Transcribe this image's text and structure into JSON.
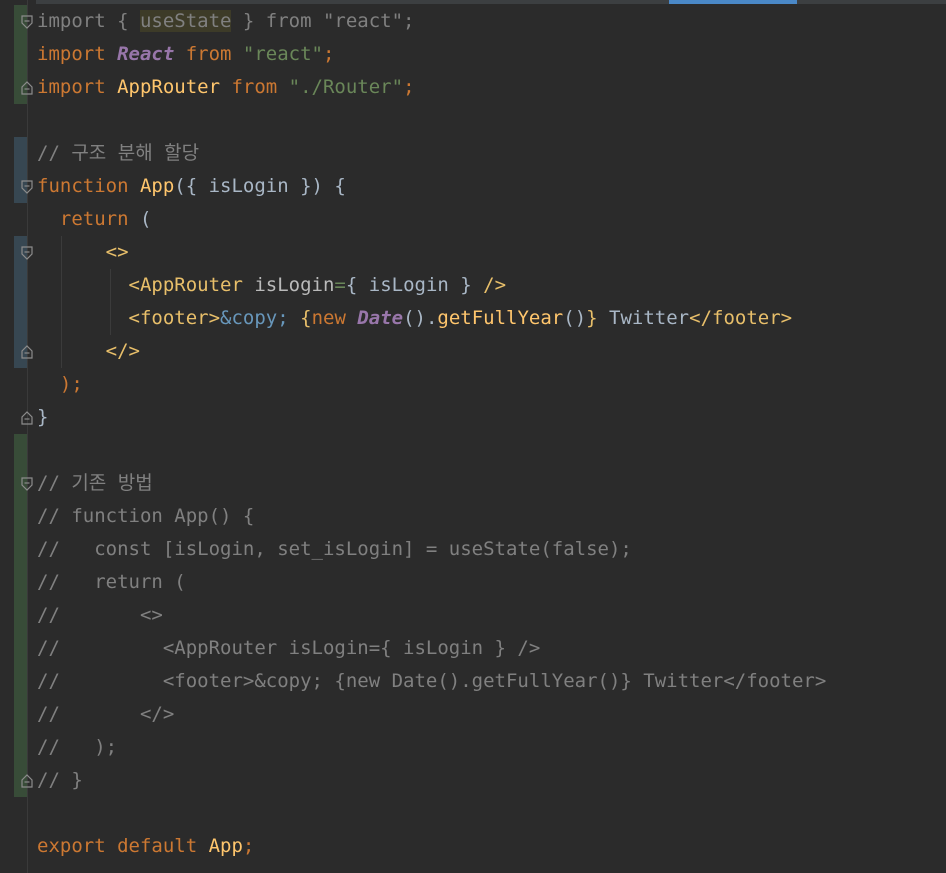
{
  "editor": {
    "lines": [
      {
        "tokens": [
          {
            "t": "import { ",
            "c": "dim"
          },
          {
            "t": "useState",
            "c": "unused hl"
          },
          {
            "t": " } from \"react\";",
            "c": "dim"
          }
        ]
      },
      {
        "tokens": [
          {
            "t": "import ",
            "c": "kw"
          },
          {
            "t": "React",
            "c": "cls"
          },
          {
            "t": " from ",
            "c": "kw"
          },
          {
            "t": "\"react\"",
            "c": "str"
          },
          {
            "t": ";",
            "c": "kw"
          }
        ]
      },
      {
        "tokens": [
          {
            "t": "import ",
            "c": "kw"
          },
          {
            "t": "AppRouter",
            "c": "fn"
          },
          {
            "t": " from ",
            "c": "kw"
          },
          {
            "t": "\"./Router\"",
            "c": "str"
          },
          {
            "t": ";",
            "c": "kw"
          }
        ]
      },
      {
        "tokens": []
      },
      {
        "tokens": [
          {
            "t": "// 구조 분해 할당",
            "c": "cmt"
          }
        ]
      },
      {
        "tokens": [
          {
            "t": "function ",
            "c": "kw"
          },
          {
            "t": "App",
            "c": "fn"
          },
          {
            "t": "({ isLogin }) {",
            "c": "plain"
          }
        ]
      },
      {
        "tokens": [
          {
            "t": "  return ",
            "c": "kw"
          },
          {
            "t": "(",
            "c": "plain"
          }
        ]
      },
      {
        "tokens": [
          {
            "t": "      <>",
            "c": "tag"
          }
        ]
      },
      {
        "tokens": [
          {
            "t": "        <AppRouter ",
            "c": "tag"
          },
          {
            "t": "isLogin",
            "c": "attr"
          },
          {
            "t": "=",
            "c": "str"
          },
          {
            "t": "{ isLogin } ",
            "c": "plain"
          },
          {
            "t": "/>",
            "c": "tag"
          }
        ]
      },
      {
        "tokens": [
          {
            "t": "        <footer>",
            "c": "tag"
          },
          {
            "t": "&copy;",
            "c": "ent"
          },
          {
            "t": " {",
            "c": "tag"
          },
          {
            "t": "new ",
            "c": "kw"
          },
          {
            "t": "Date",
            "c": "cls"
          },
          {
            "t": "().",
            "c": "plain"
          },
          {
            "t": "getFullYear",
            "c": "fn"
          },
          {
            "t": "()",
            "c": "plain"
          },
          {
            "t": "}",
            "c": "tag"
          },
          {
            "t": " Twitter",
            "c": "plain"
          },
          {
            "t": "</footer>",
            "c": "tag"
          }
        ]
      },
      {
        "tokens": [
          {
            "t": "      </>",
            "c": "tag"
          }
        ]
      },
      {
        "tokens": [
          {
            "t": "  );",
            "c": "kw"
          }
        ]
      },
      {
        "tokens": [
          {
            "t": "}",
            "c": "plain"
          }
        ]
      },
      {
        "tokens": []
      },
      {
        "tokens": [
          {
            "t": "// 기존 방법",
            "c": "cmt"
          }
        ]
      },
      {
        "tokens": [
          {
            "t": "// function App() {",
            "c": "cmt"
          }
        ]
      },
      {
        "tokens": [
          {
            "t": "//   const [isLogin, set_isLogin] = useState(false);",
            "c": "cmt"
          }
        ]
      },
      {
        "tokens": [
          {
            "t": "//   return (",
            "c": "cmt"
          }
        ]
      },
      {
        "tokens": [
          {
            "t": "//       <>",
            "c": "cmt"
          }
        ]
      },
      {
        "tokens": [
          {
            "t": "//         <AppRouter isLogin={ isLogin } />",
            "c": "cmt"
          }
        ]
      },
      {
        "tokens": [
          {
            "t": "//         <footer>&copy; {new Date().getFullYear()} Twitter</footer>",
            "c": "cmt"
          }
        ]
      },
      {
        "tokens": [
          {
            "t": "//       </>",
            "c": "cmt"
          }
        ]
      },
      {
        "tokens": [
          {
            "t": "//   );",
            "c": "cmt"
          }
        ]
      },
      {
        "tokens": [
          {
            "t": "// }",
            "c": "cmt"
          }
        ]
      },
      {
        "tokens": []
      },
      {
        "tokens": [
          {
            "t": "export ",
            "c": "kw"
          },
          {
            "t": "default ",
            "c": "kw"
          },
          {
            "t": "App",
            "c": "fn"
          },
          {
            "t": ";",
            "c": "kw"
          }
        ]
      }
    ],
    "fold_markers": [
      {
        "line": 0,
        "kind": "open"
      },
      {
        "line": 2,
        "kind": "close"
      },
      {
        "line": 5,
        "kind": "open"
      },
      {
        "line": 7,
        "kind": "open"
      },
      {
        "line": 10,
        "kind": "close"
      },
      {
        "line": 12,
        "kind": "close"
      },
      {
        "line": 14,
        "kind": "open"
      },
      {
        "line": 23,
        "kind": "close"
      }
    ],
    "change_markers": [
      {
        "from": 0,
        "to": 2,
        "kind": "added"
      },
      {
        "from": 4,
        "to": 5,
        "kind": "mod"
      },
      {
        "from": 7,
        "to": 10,
        "kind": "mod"
      },
      {
        "from": 13,
        "to": 23,
        "kind": "added"
      }
    ],
    "colors": {
      "background": "#2b2b2b",
      "keyword": "#cc7832",
      "string": "#6a8759",
      "function": "#ffc66d",
      "comment": "#808080",
      "tab_indicator": "#4a88c7"
    }
  }
}
